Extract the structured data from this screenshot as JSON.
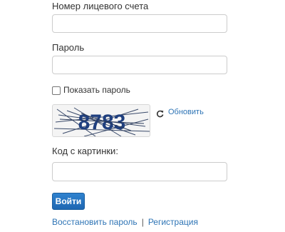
{
  "form": {
    "account_label": "Номер лицевого счета",
    "account_value": "",
    "password_label": "Пароль",
    "password_value": "",
    "show_password_label": "Показать пароль",
    "show_password_checked": false,
    "captcha_text": "8783",
    "refresh_label": "Обновить",
    "refresh_icon": "refresh-icon",
    "captcha_code_label": "Код с картинки:",
    "captcha_code_value": "",
    "submit_label": "Войти"
  },
  "links": {
    "restore_password": "Восстановить пароль",
    "separator": "|",
    "register": "Регистрация"
  },
  "colors": {
    "accent": "#2e74b5",
    "button": "#2575c2",
    "captcha_text": "#1f3f7f"
  }
}
